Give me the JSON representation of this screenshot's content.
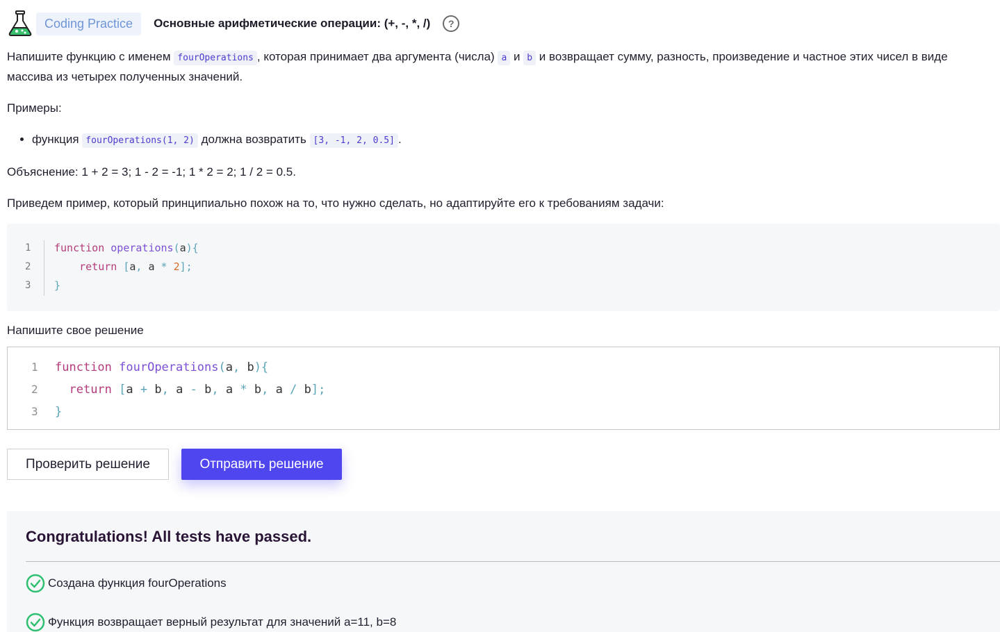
{
  "header": {
    "badge": "Coding Practice",
    "title": "Основные арифметические операции: (+, -, *, /)",
    "help": "?"
  },
  "task": {
    "p1_a": "Напишите функцию с именем ",
    "p1_code": "fourOperations",
    "p1_b": ", которая принимает два аргумента (числа) ",
    "p1_arg_a": "a",
    "p1_c": " и ",
    "p1_arg_b": "b",
    "p1_d": " и возвращает сумму, разность, произведение и частное этих чисел в виде массива из четырех полученных значений.",
    "examples_label": "Примеры:",
    "ex1_a": "функция ",
    "ex1_code": "fourOperations(1, 2)",
    "ex1_b": " должна возвратить ",
    "ex1_result": "[3, -1, 2, 0.5]",
    "ex1_c": ".",
    "explanation": "Объяснение: 1 + 2 = 3; 1 - 2 = -1; 1 * 2 = 2; 1 / 2 = 0.5.",
    "hint": "Приведем пример, который принципиально похож на то, что нужно сделать, но адаптируйте его к требованиям задачи:"
  },
  "example_code": {
    "line_numbers": [
      "1",
      "2",
      "3"
    ],
    "kw_function": "function",
    "fn_name": "operations",
    "kw_return": "return",
    "param": "a",
    "num": "2"
  },
  "solution": {
    "label": "Напишите свое решение",
    "line_numbers": [
      "1",
      "2",
      "3"
    ],
    "kw_function": "function",
    "fn_name": "fourOperations",
    "kw_return": "return",
    "param_a": "a",
    "param_b": "b"
  },
  "buttons": {
    "check": "Проверить решение",
    "submit": "Отправить решение"
  },
  "results": {
    "title": "Congratulations! All tests have passed.",
    "items": [
      "Создана функция fourOperations",
      "Функция возвращает верный результат для значений a=11, b=8"
    ]
  },
  "colors": {
    "accent": "#5046f0",
    "success": "#2fbf71",
    "badge_text": "#6f95d6"
  }
}
